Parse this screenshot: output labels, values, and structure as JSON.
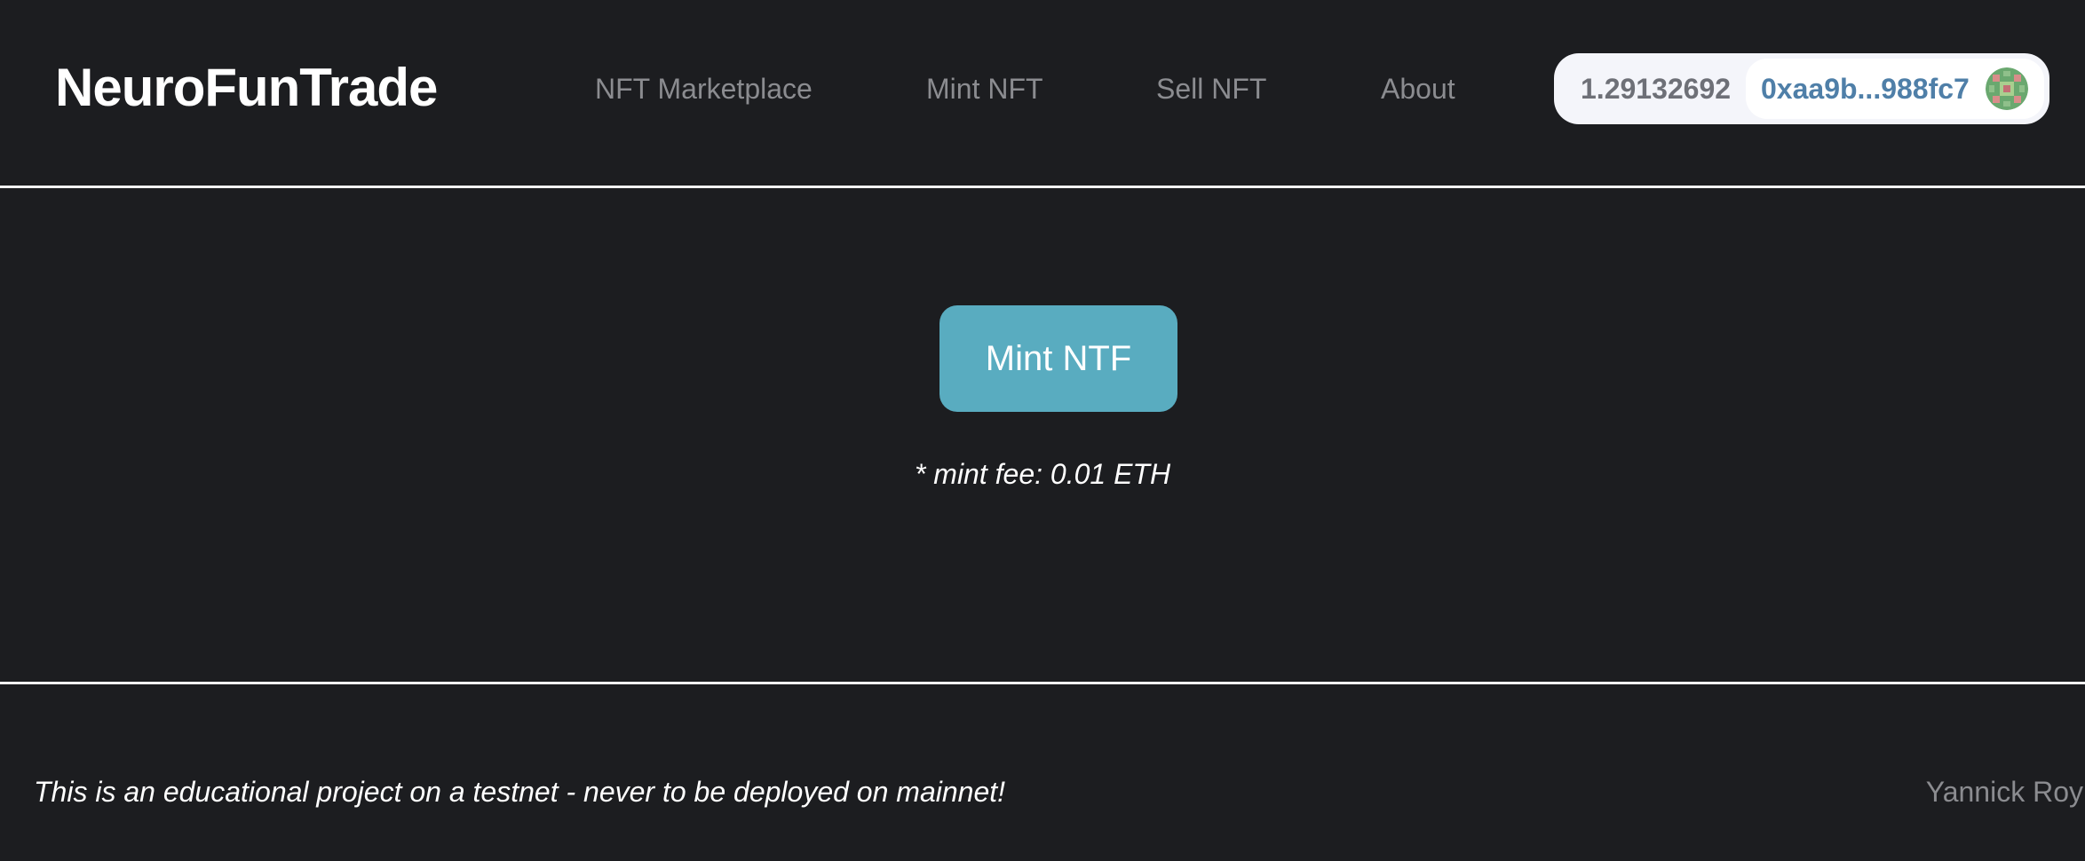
{
  "header": {
    "logo": "NeuroFunTrade",
    "nav": [
      {
        "label": "NFT Marketplace"
      },
      {
        "label": "Mint NFT"
      },
      {
        "label": "Sell NFT"
      },
      {
        "label": "About"
      }
    ],
    "wallet": {
      "balance": "1.29132692",
      "address": "0xaa9b...988fc7",
      "avatar_icon": "identicon-avatar"
    }
  },
  "main": {
    "mint_button_label": "Mint NTF",
    "fee_note": "* mint fee: 0.01 ETH"
  },
  "footer": {
    "note": "This is an educational project on a testnet - never to be deployed on mainnet!",
    "author": "Yannick Roy"
  },
  "colors": {
    "background": "#1c1d20",
    "accent_button": "#59acc0",
    "nav_text": "#8b8c90",
    "address_text": "#4f7fa8"
  }
}
